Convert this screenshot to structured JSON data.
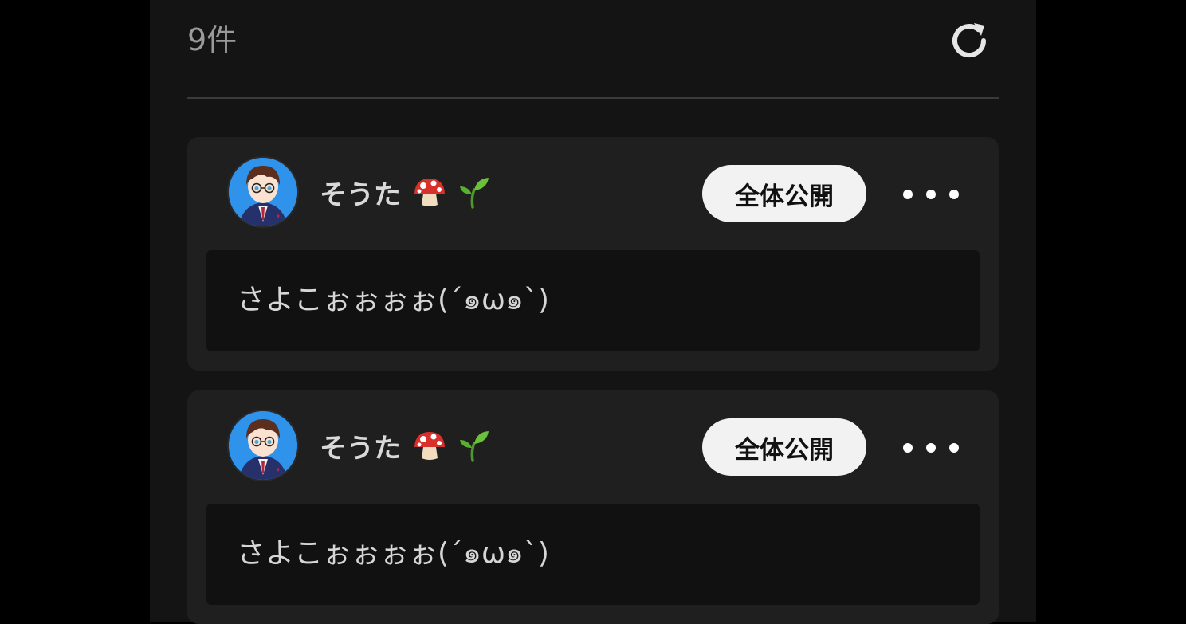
{
  "header": {
    "count": "9件"
  },
  "icons": {
    "refresh": "refresh-icon",
    "mushroom": "mushroom-emoji",
    "seedling": "seedling-emoji",
    "more": "ellipsis-icon"
  },
  "posts": [
    {
      "username": "そうた",
      "visibility": "全体公開",
      "text": "さよこぉぉぉぉ(´๑ω๑`)"
    },
    {
      "username": "そうた",
      "visibility": "全体公開",
      "text": "さよこぉぉぉぉ(´๑ω๑`)"
    }
  ],
  "colors": {
    "page_bg": "#000000",
    "panel_bg": "#141414",
    "card_bg": "#1f1f1f",
    "content_bg": "#111111",
    "pill_bg": "#f2f2f2"
  }
}
